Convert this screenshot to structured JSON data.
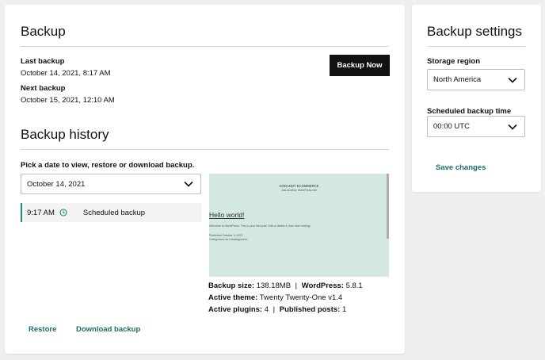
{
  "backup": {
    "title": "Backup",
    "last_label": "Last backup",
    "last_value": "October 14, 2021, 8:17 AM",
    "next_label": "Next backup",
    "next_value": "October 15, 2021, 12:10 AM",
    "backup_now_label": "Backup Now"
  },
  "history": {
    "title": "Backup history",
    "instruction": "Pick a date to view, restore or download backup.",
    "date_select": "October 14, 2021",
    "entries": [
      {
        "time": "9:17 AM",
        "type": "Scheduled backup",
        "icon": "clock-icon"
      }
    ],
    "restore_label": "Restore",
    "download_label": "Download backup"
  },
  "preview": {
    "site_name": "GODADDY ECOMMERCE",
    "tagline": "Just another WordPress site",
    "post_title": "Hello world!",
    "post_body": "Welcome to WordPress. This is your first post. Edit or delete it, then start writing!",
    "post_meta1": "Published October 4, 2021",
    "post_meta2": "Categorized as Uncategorized"
  },
  "details": {
    "size_label": "Backup size:",
    "size_value": "138.18MB",
    "sep": "|",
    "wp_label": "WordPress:",
    "wp_value": "5.8.1",
    "theme_label": "Active theme:",
    "theme_value": "Twenty Twenty-One v1.4",
    "plugins_label": "Active plugins:",
    "plugins_value": "4",
    "posts_label": "Published posts:",
    "posts_value": "1"
  },
  "settings": {
    "title": "Backup settings",
    "region_label": "Storage region",
    "region_value": "North America",
    "time_label": "Scheduled backup time",
    "time_value": "00:00 UTC",
    "save_label": "Save changes"
  },
  "colors": {
    "accent": "#1c6e68",
    "preview_bg": "#d3e8e1",
    "dark_button": "#111111"
  }
}
